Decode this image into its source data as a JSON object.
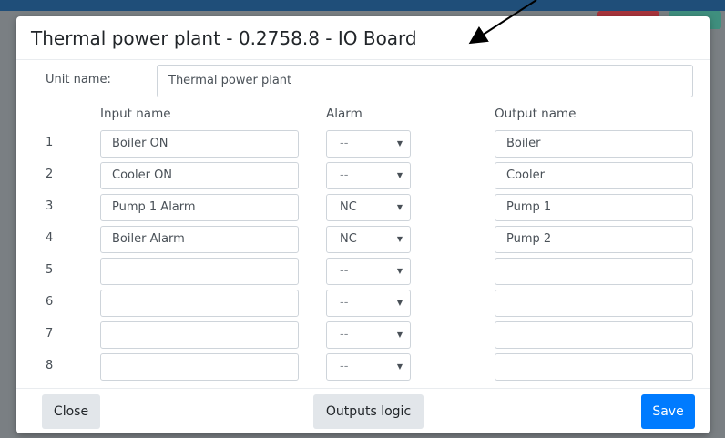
{
  "dialog": {
    "title": "Thermal power plant - 0.2758.8 - IO Board",
    "unit_label": "Unit name:",
    "unit_value": "Thermal power plant"
  },
  "columns": {
    "input": "Input name",
    "alarm": "Alarm",
    "output": "Output name"
  },
  "rows": [
    {
      "num": "1",
      "input": "Boiler ON",
      "alarm": "--",
      "output": "Boiler"
    },
    {
      "num": "2",
      "input": "Cooler ON",
      "alarm": "--",
      "output": "Cooler"
    },
    {
      "num": "3",
      "input": "Pump 1 Alarm",
      "alarm": "NC",
      "output": "Pump 1"
    },
    {
      "num": "4",
      "input": "Boiler Alarm",
      "alarm": "NC",
      "output": "Pump 2"
    },
    {
      "num": "5",
      "input": "",
      "alarm": "--",
      "output": ""
    },
    {
      "num": "6",
      "input": "",
      "alarm": "--",
      "output": ""
    },
    {
      "num": "7",
      "input": "",
      "alarm": "--",
      "output": ""
    },
    {
      "num": "8",
      "input": "",
      "alarm": "--",
      "output": ""
    }
  ],
  "footer": {
    "close": "Close",
    "outputs_logic": "Outputs logic",
    "save": "Save"
  },
  "colors": {
    "save": "#007bff",
    "backdrop": "#7a7f83"
  }
}
